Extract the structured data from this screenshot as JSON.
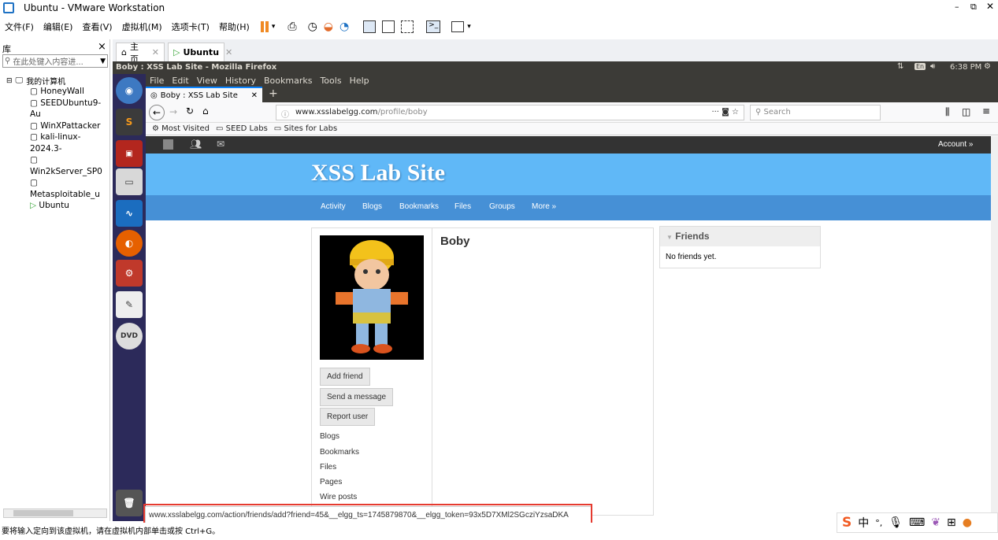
{
  "host": {
    "title": "Ubuntu - VMware Workstation",
    "menu": [
      "文件(F)",
      "编辑(E)",
      "查看(V)",
      "虚拟机(M)",
      "选项卡(T)",
      "帮助(H)"
    ],
    "library": {
      "title": "库",
      "close": "×",
      "search_placeholder": "在此处键入内容进...",
      "root": "我的计算机",
      "items": [
        "HoneyWall",
        "SEEDUbuntu9-Au",
        "WinXPattacker",
        "kali-linux-2024.3-",
        "Win2kServer_SP0",
        "Metasploitable_u",
        "Ubuntu"
      ]
    },
    "tabs": [
      "主页",
      "Ubuntu"
    ],
    "status_text": "要将输入定向到该虚拟机，请在虚拟机内部单击或按 Ctrl+G。",
    "ime": [
      "中",
      "°,"
    ]
  },
  "ubuntu": {
    "window_title": "Boby : XSS Lab Site - Mozilla Firefox",
    "time": "6:38 PM",
    "lang": "En"
  },
  "firefox": {
    "menu": [
      "File",
      "Edit",
      "View",
      "History",
      "Bookmarks",
      "Tools",
      "Help"
    ],
    "tab_title": "Boby : XSS Lab Site",
    "url_domain": "www.xsslabelgg.com",
    "url_path": "/profile/boby",
    "search_placeholder": "Search",
    "bookmarks": [
      "Most Visited",
      "SEED Labs",
      "Sites for Labs"
    ],
    "status_url": "www.xsslabelgg.com/action/friends/add?friend=45&__elgg_ts=1745879870&__elgg_token=93x5D7XMl2SGcziYzsaDKA"
  },
  "site": {
    "account": "Account »",
    "title": "XSS Lab Site",
    "nav": [
      "Activity",
      "Blogs",
      "Bookmarks",
      "Files",
      "Groups",
      "More »"
    ],
    "profile_name": "Boby",
    "buttons": [
      "Add friend",
      "Send a message",
      "Report user"
    ],
    "links": [
      "Blogs",
      "Bookmarks",
      "Files",
      "Pages",
      "Wire posts"
    ],
    "friends_title": "Friends",
    "friends_empty": "No friends yet."
  }
}
